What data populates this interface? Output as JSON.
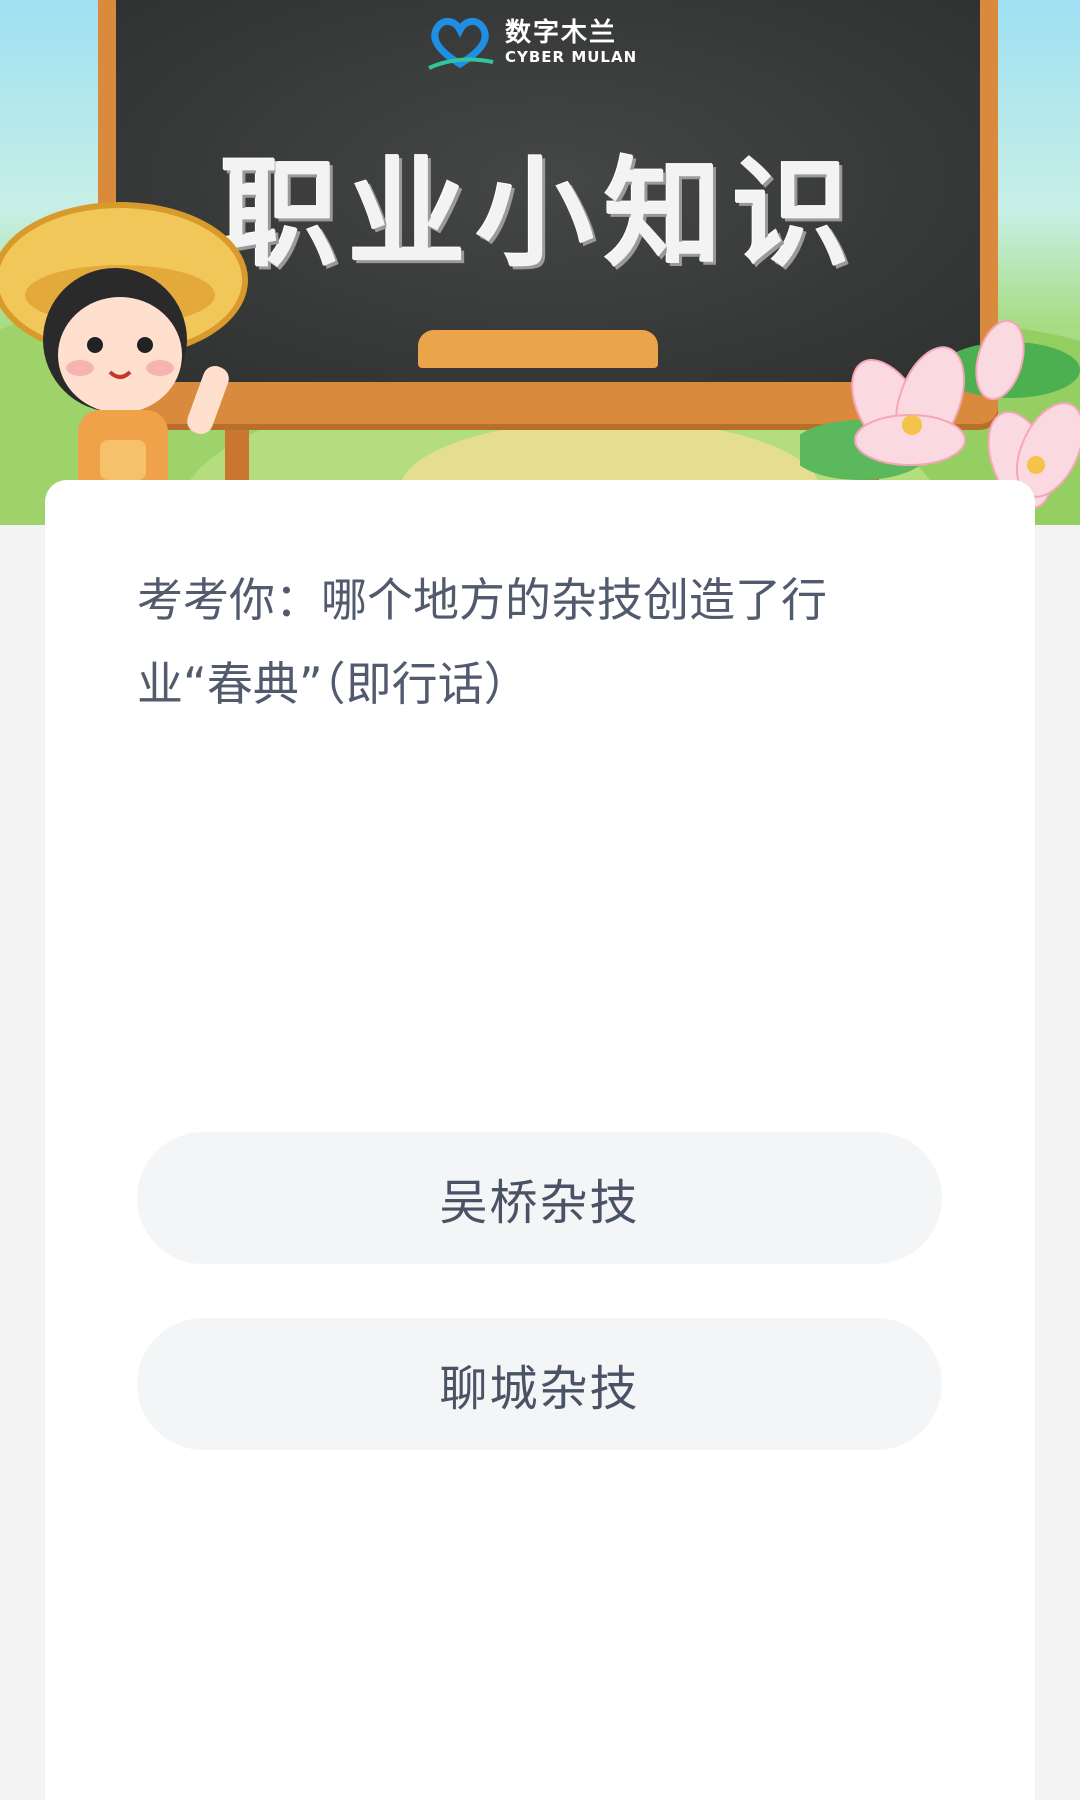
{
  "banner": {
    "logo_cn": "数字木兰",
    "logo_en": "CYBER MULAN",
    "title": "职业小知识"
  },
  "quiz": {
    "question": "考考你：哪个地方的杂技创造了行业“春典”（即行话）",
    "options": [
      {
        "label": "吴桥杂技"
      },
      {
        "label": "聊城杂技"
      }
    ]
  },
  "colors": {
    "accent_board": "#2f3131",
    "frame": "#d98a3d",
    "option_bg": "#f4f5f7",
    "text": "#525a6e"
  }
}
